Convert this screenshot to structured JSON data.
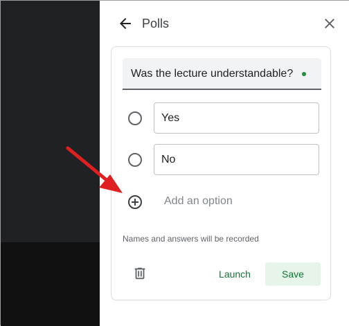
{
  "panel": {
    "title": "Polls",
    "back_icon": "arrow-back-icon",
    "close_icon": "close-icon"
  },
  "poll": {
    "question": "Was the lecture understandable?",
    "options": [
      {
        "label": "Yes"
      },
      {
        "label": "No"
      }
    ],
    "add_option_label": "Add an option",
    "add_option_icon": "add-circle-icon",
    "note": "Names and answers will be recorded",
    "delete_icon": "trash-icon",
    "launch_label": "Launch",
    "save_label": "Save"
  },
  "colors": {
    "accent_green": "#137333",
    "save_bg": "#e6f4ea",
    "annotation_arrow": "#e02020"
  }
}
